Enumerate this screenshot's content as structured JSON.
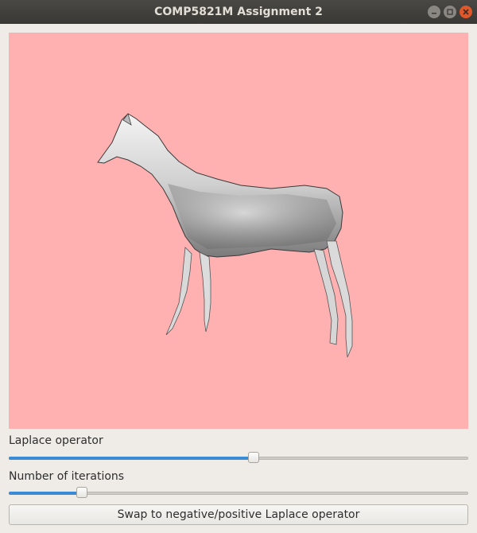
{
  "window": {
    "title": "COMP5821M Assignment 2",
    "controls": [
      "minimize-icon",
      "maximize-icon",
      "close-icon"
    ]
  },
  "viewport": {
    "background_color": "#ffb0b1",
    "model": "horse-mesh"
  },
  "controls": {
    "laplace": {
      "label": "Laplace operator",
      "value_fraction": 0.53
    },
    "iterations": {
      "label": "Number of iterations",
      "value_fraction": 0.16
    },
    "swap_button_label": "Swap to negative/positive Laplace operator"
  },
  "colors": {
    "slider_fill": "#3a8bd6",
    "close_button": "#e0572a"
  }
}
